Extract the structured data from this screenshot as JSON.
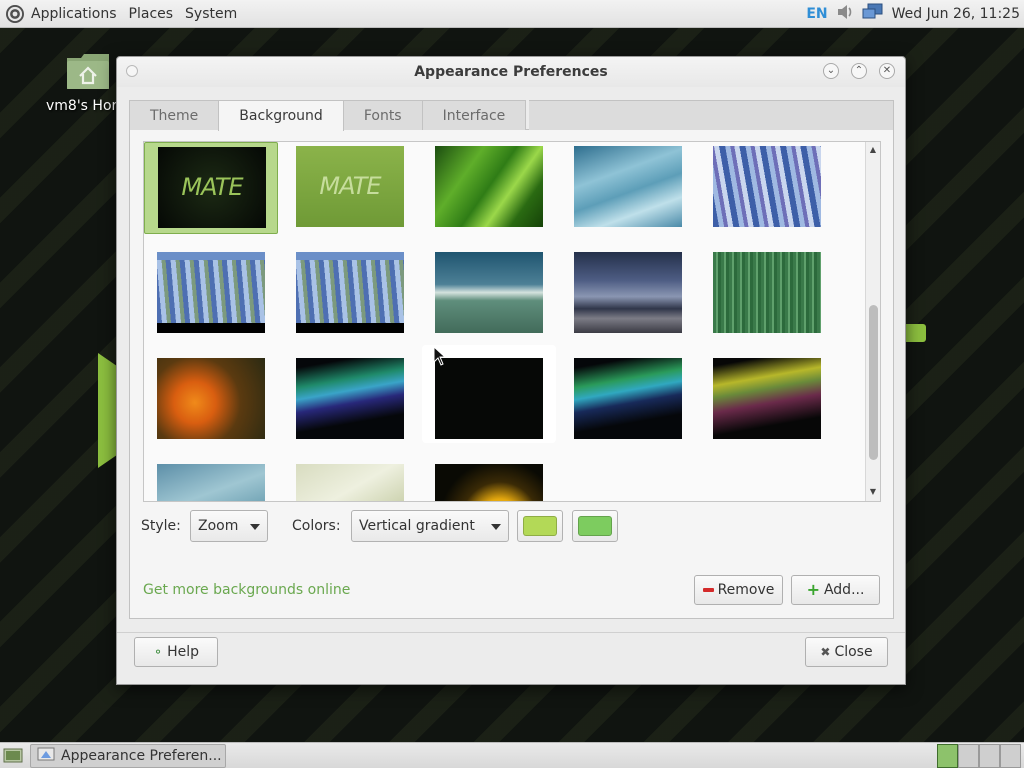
{
  "top_panel": {
    "menus": [
      "Applications",
      "Places",
      "System"
    ],
    "keyboard_layout": "EN",
    "clock": "Wed Jun 26, 11:25"
  },
  "desktop": {
    "home_icon_label": "vm8's Hor"
  },
  "dialog": {
    "title": "Appearance Preferences",
    "tabs": [
      "Theme",
      "Background",
      "Fonts",
      "Interface"
    ],
    "active_tab": "Background",
    "wallpapers": [
      {
        "name": "mate-dark",
        "text": "MATE"
      },
      {
        "name": "mate-green",
        "text": "MATE"
      },
      {
        "name": "green-leaf"
      },
      {
        "name": "blue-waves"
      },
      {
        "name": "blue-painting"
      },
      {
        "name": "blue-flowers-1"
      },
      {
        "name": "blue-flowers-2"
      },
      {
        "name": "teal-cloud"
      },
      {
        "name": "stormy-sea"
      },
      {
        "name": "green-curtain"
      },
      {
        "name": "orange-flower"
      },
      {
        "name": "aurora-green"
      },
      {
        "name": "dark-blank"
      },
      {
        "name": "aurora-teal"
      },
      {
        "name": "aurora-yellow"
      },
      {
        "name": "blue-waves-2"
      },
      {
        "name": "pale-green"
      },
      {
        "name": "yellow-flower"
      }
    ],
    "style_label": "Style:",
    "style_value": "Zoom",
    "colors_label": "Colors:",
    "colors_value": "Vertical gradient",
    "primary_color": "#b3d957",
    "secondary_color": "#7dcc5f",
    "more_link": "Get more backgrounds online",
    "remove_label": "Remove",
    "add_label": "Add...",
    "help_label": "Help",
    "close_label": "Close"
  },
  "bottom_panel": {
    "task_label": "Appearance Preferen..."
  }
}
